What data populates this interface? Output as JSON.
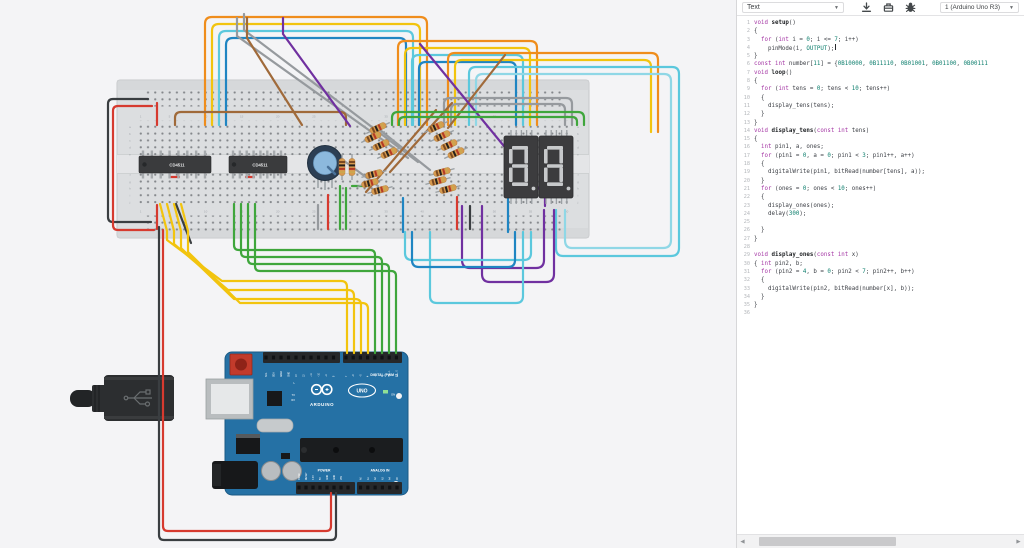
{
  "code_panel": {
    "toolbar": {
      "mode_label": "Text",
      "board_label": "1 (Arduino Uno R3)",
      "icons": [
        "download-icon",
        "toolbox-icon",
        "debug-icon"
      ]
    },
    "cursor_line": 4,
    "lines": [
      "void setup()",
      "{",
      "  for (int i = 0; i <= 7; i++)",
      "    pinMode(i, OUTPUT);",
      "}",
      "const int number[11] = {0B10000, 0B11110, 0B01001, 0B01100, 0B00111",
      "void loop()",
      "{",
      "  for (int tens = 0; tens < 10; tens++)",
      "  {",
      "    display_tens(tens);",
      "  }",
      "}",
      "void display_tens(const int tens)",
      "{",
      "  int pin1, a, ones;",
      "  for (pin1 = 0, a = 0; pin1 < 3; pin1++, a++)",
      "  {",
      "    digitalWrite(pin1, bitRead(number[tens], a));",
      "  }",
      "  for (ones = 0; ones < 10; ones++)",
      "  {",
      "    display_ones(ones);",
      "    delay(300);",
      "",
      "  }",
      "}",
      "",
      "void display_ones(const int x)",
      "{ int pin2, b;",
      "  for (pin2 = 4, b = 0; pin2 < 7; pin2++, b++)",
      "  {",
      "    digitalWrite(pin2, bitRead(number[x], b));",
      "  }",
      "}",
      ""
    ],
    "scrollbar": {
      "orientation": "horizontal",
      "thumb_left_pct": 4,
      "thumb_width_pct": 52,
      "left_arrow": "◀",
      "right_arrow": "▶"
    }
  },
  "circuit": {
    "breadboard": {
      "row_letters_top": [
        "a",
        "b",
        "c",
        "d",
        "e"
      ],
      "row_letters_bottom": [
        "f",
        "g",
        "h",
        "i",
        "j"
      ],
      "column_numbers": [
        "1",
        "5",
        "10",
        "15",
        "20",
        "25",
        "30",
        "35",
        "40",
        "45",
        "50",
        "55",
        "60"
      ]
    },
    "chips": [
      {
        "label": "CD4511"
      },
      {
        "label": "CD4511"
      }
    ],
    "seven_segment_displays": {
      "count": 2,
      "value": "8.8."
    },
    "arduino": {
      "brand": "ARDUINO",
      "model": "UNO",
      "digital_label": "DIGITAL (PWM ~)",
      "power_label": "POWER",
      "analog_label": "ANALOG IN",
      "tx": "TX",
      "rx": "RX",
      "led_l": "L",
      "led_on": "ON",
      "pin_labels_digital_left": [
        "SCL",
        "SDA",
        "AREF",
        "GND",
        "13",
        "12",
        "~11",
        "~10",
        "~9",
        "8"
      ],
      "pin_labels_digital_right": [
        "7",
        "~6",
        "~5",
        "4",
        "~3",
        "2",
        "TX→1",
        "RX←0"
      ],
      "pin_labels_power": [
        "IOREF",
        "RESET",
        "3.3V",
        "5V",
        "GND",
        "GND",
        "VIN"
      ],
      "pin_labels_analog": [
        "A0",
        "A1",
        "A2",
        "A3",
        "A4",
        "A5"
      ]
    },
    "colors": {
      "canvas": "#f4f4f6",
      "breadboard": "#dcdee0",
      "breadboard_channel": "#e4e5e7",
      "chip": "#3a3b3d",
      "display_body": "#3c3c3e",
      "display_segment": "#c7c9cb",
      "arduino_board": "#2571a5",
      "pot_body": "#2c3f54",
      "pot_knob": "#8cb9dd",
      "resistor_body": "#d79a4e"
    },
    "wire_colors": {
      "red": "#d63a2f",
      "black": "#3a3e41",
      "yellow": "#f2c40e",
      "green": "#3fa63c",
      "orange": "#ef8d1c",
      "cyan": "#5bc8dd",
      "light_cyan": "#8fd7e6",
      "blue": "#1f85c2",
      "purple": "#7030a0",
      "gray": "#969a9e",
      "brown": "#a06a3a"
    }
  }
}
